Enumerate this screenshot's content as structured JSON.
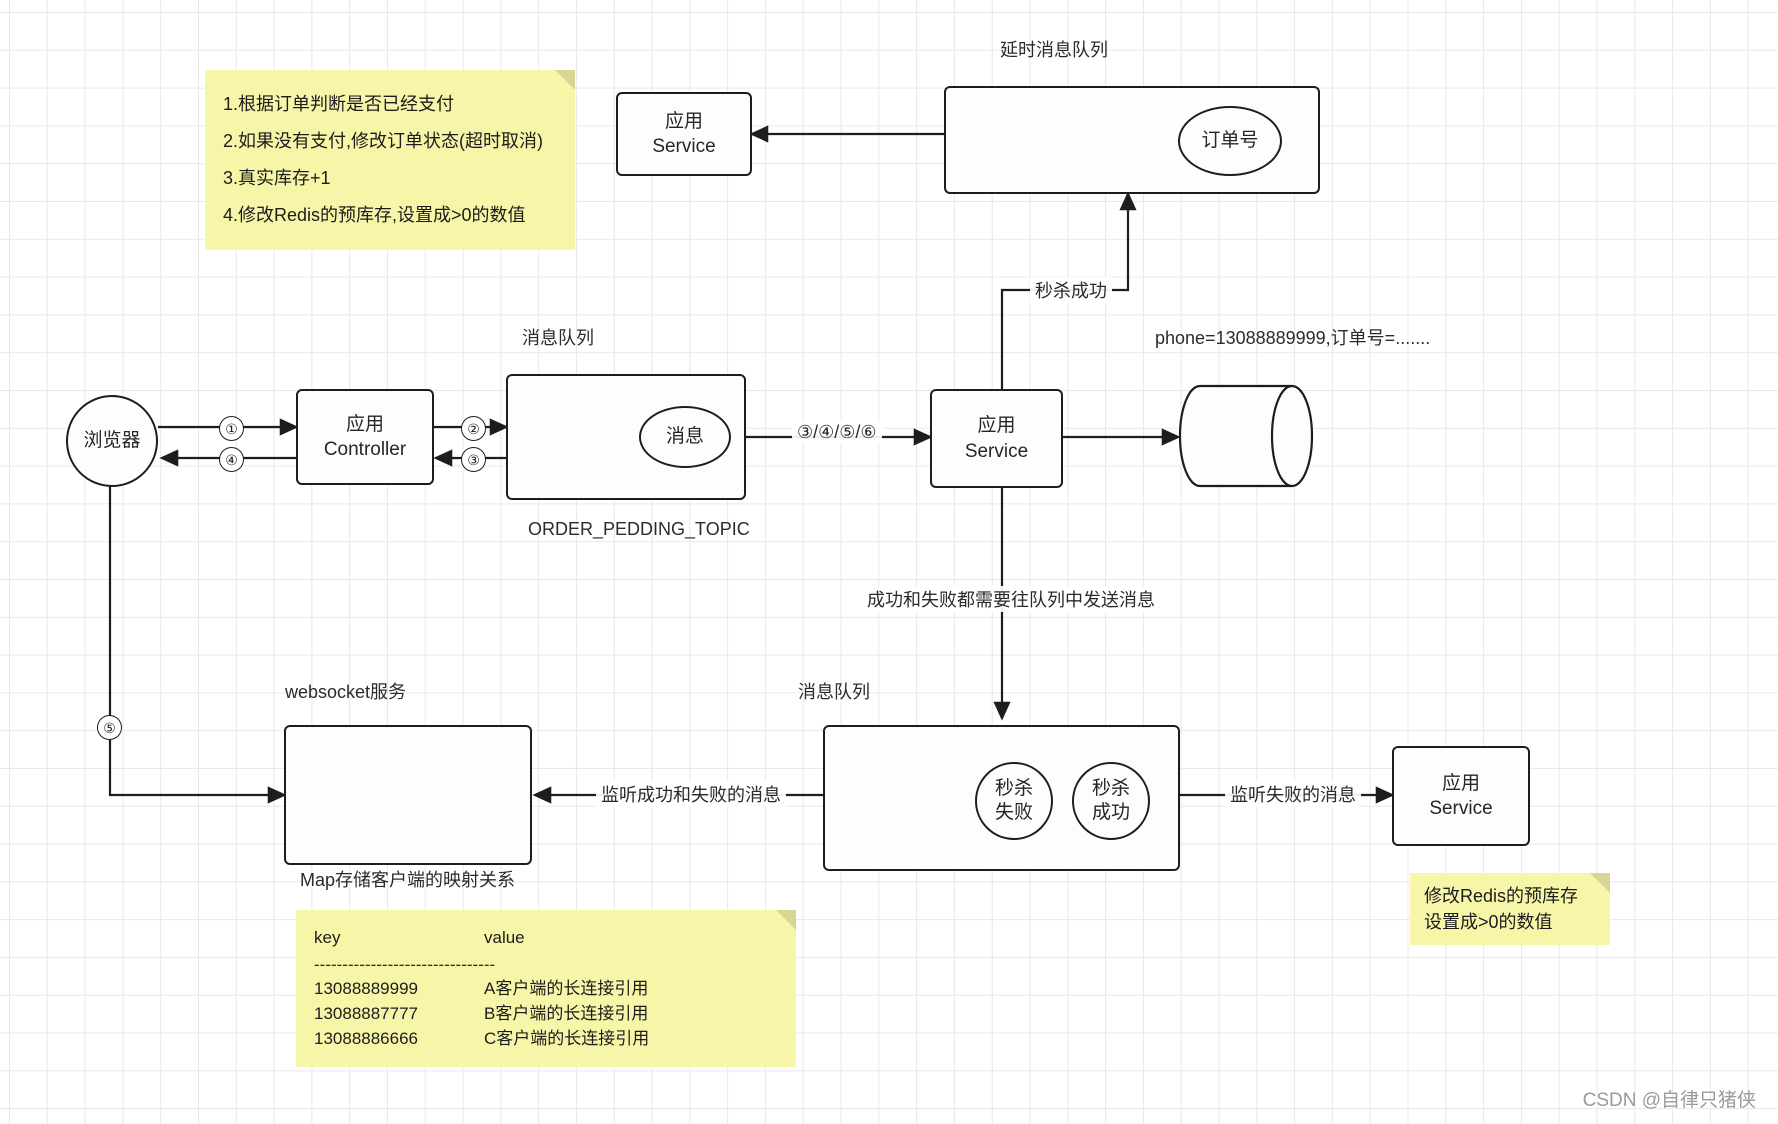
{
  "diagram": {
    "title": "seckill-order-flow-diagram",
    "watermark": "CSDN @自律只猪侠"
  },
  "notes": {
    "top_left": {
      "lines": [
        "1.根据订单判断是否已经支付",
        "2.如果没有支付,修改订单状态(超时取消)",
        "3.真实库存+1",
        "4.修改Redis的预库存,设置成>0的数值"
      ]
    },
    "bottom_right": {
      "lines": [
        "修改Redis的预库存",
        "设置成>0的数值"
      ]
    },
    "kv_note": {
      "header": {
        "key": "key",
        "value": "value"
      },
      "divider": "--------------------------------",
      "rows": [
        {
          "key": "13088889999",
          "value": "A客户端的长连接引用"
        },
        {
          "key": "13088887777",
          "value": "B客户端的长连接引用"
        },
        {
          "key": "13088886666",
          "value": "C客户端的长连接引用"
        }
      ]
    }
  },
  "nodes": {
    "browser": {
      "label": "浏览器"
    },
    "app_controller": {
      "line1": "应用",
      "line2": "Controller"
    },
    "order_pedding_queue": {
      "caption": "消息队列",
      "inner": "消息",
      "topic": "ORDER_PEDDING_TOPIC"
    },
    "app_service_mid": {
      "line1": "应用",
      "line2": "Service"
    },
    "database": {
      "label": ""
    },
    "delay_queue": {
      "caption": "延时消息队列",
      "inner": "订单号"
    },
    "app_service_top": {
      "line1": "应用",
      "line2": "Service"
    },
    "websocket_service": {
      "caption": "websocket服务",
      "footer": "Map存储客户端的映射关系"
    },
    "result_queue": {
      "caption": "消息队列",
      "fail": "秒杀\n失败",
      "fail_l1": "秒杀",
      "fail_l2": "失败",
      "success_l1": "秒杀",
      "success_l2": "成功"
    },
    "app_service_bottom": {
      "line1": "应用",
      "line2": "Service"
    }
  },
  "edge_labels": {
    "n1": "①",
    "n2": "②",
    "n3": "③",
    "n4": "④",
    "n5": "⑤",
    "consume_group": "③/④/⑤/⑥",
    "seckill_success": "秒杀成功",
    "phone_payload": "phone=13088889999,订单号=.......",
    "send_to_queue": "成功和失败都需要往队列中发送消息",
    "listen_success_fail": "监听成功和失败的消息",
    "listen_fail": "监听失败的消息"
  },
  "colors": {
    "note_bg": "#f7f6a8",
    "stroke": "#1d1d1d",
    "grid": "#e8e8e8",
    "text": "#262626"
  }
}
